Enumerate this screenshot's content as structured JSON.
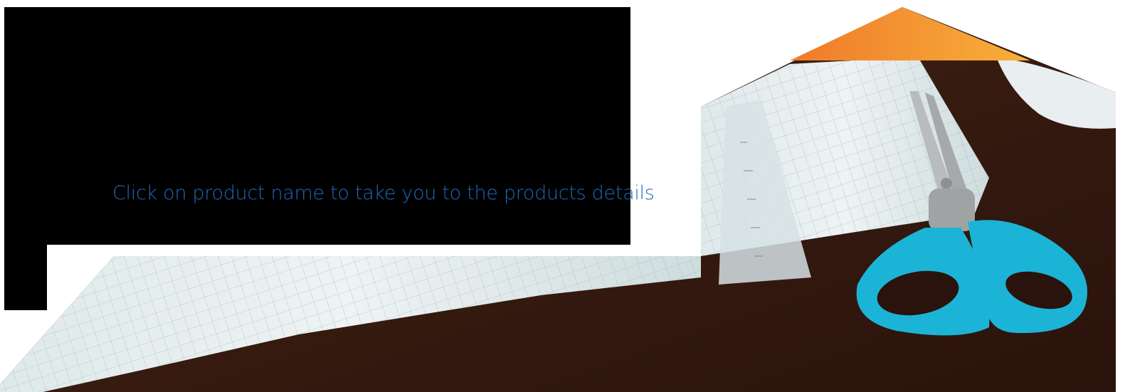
{
  "hero": {
    "link_text": "Click on product name to take you to the products details",
    "image_description_icon": "desk-photo",
    "colors": {
      "link": "#1f68b9",
      "panel": "#000000",
      "roof_start": "#f07a2b",
      "roof_end": "#f7b03a",
      "desk": "#3a1f17",
      "scissor_handle": "#1bb4d6"
    }
  }
}
